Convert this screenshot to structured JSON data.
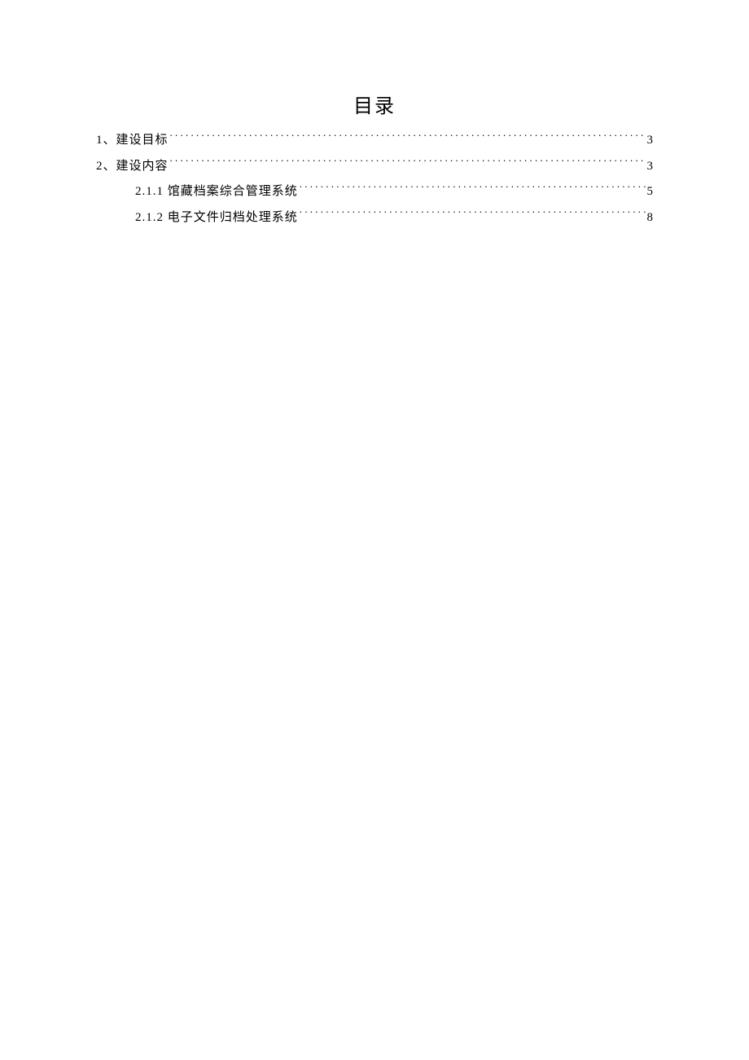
{
  "title": "目录",
  "toc": [
    {
      "level": 1,
      "label": "1、建设目标",
      "page": "3"
    },
    {
      "level": 1,
      "label": "2、建设内容",
      "page": "3"
    },
    {
      "level": 2,
      "label": "2.1.1 馆藏档案综合管理系统",
      "page": "5"
    },
    {
      "level": 2,
      "label": "2.1.2 电子文件归档处理系统",
      "page": "8"
    }
  ]
}
